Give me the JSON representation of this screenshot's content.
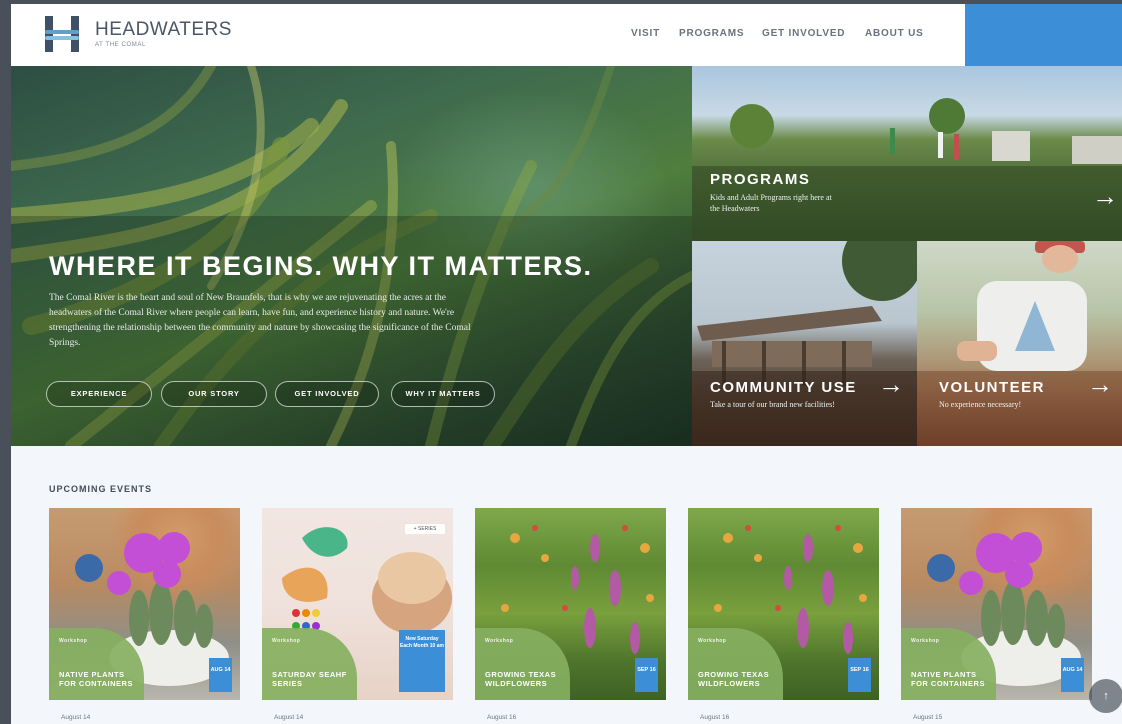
{
  "header": {
    "brand": "HEADWATERS",
    "brand_sub": "AT THE COMAL",
    "nav": [
      "VISIT",
      "PROGRAMS",
      "GET INVOLVED",
      "ABOUT US"
    ]
  },
  "hero": {
    "title": "WHERE IT BEGINS. WHY IT MATTERS.",
    "body": "The Comal River is the heart and soul of New Braunfels, that is why we are rejuvenating the acres at the headwaters of the Comal River where people can learn, have fun, and experience history and nature. We're strengthening the relationship between the community and nature by showcasing the significance of the Comal Springs.",
    "buttons": [
      "EXPERIENCE",
      "OUR STORY",
      "GET INVOLVED",
      "WHY IT MATTERS"
    ]
  },
  "tiles": {
    "programs": {
      "title": "PROGRAMS",
      "desc": "Kids and Adult Programs right here at the Headwaters"
    },
    "community": {
      "title": "COMMUNITY USE",
      "desc": "Take a tour of our brand new facilities!"
    },
    "volunteer": {
      "title": "VOLUNTEER",
      "desc": "No experience necessary!"
    }
  },
  "events": {
    "heading": "UPCOMING EVENTS",
    "cards": [
      {
        "category": "Workshop",
        "title": "NATIVE PLANTS FOR CONTAINERS",
        "date_box": "AUG 14",
        "date": "August 14"
      },
      {
        "category": "Workshop",
        "title": "SATURDAY SEAHF SERIES",
        "date_box": "New Saturday Each Month 10 am",
        "date": "August 14",
        "tag": "+ SERIES"
      },
      {
        "category": "Workshop",
        "title": "GROWING TEXAS WILDFLOWERS",
        "date_box": "SEP 16",
        "date": "August 16"
      },
      {
        "category": "Workshop",
        "title": "GROWING TEXAS WILDFLOWERS",
        "date_box": "SEP 16",
        "date": "August 16"
      },
      {
        "category": "Workshop",
        "title": "NATIVE PLANTS FOR CONTAINERS",
        "date_box": "AUG 14",
        "date": "August 15"
      }
    ]
  },
  "icons": {
    "arrow": "right-arrow-icon",
    "logo": "headwaters-h-logo"
  },
  "colors": {
    "accent_blue": "#3c8fd7",
    "badge_green": "#86b060",
    "header_bg": "#ffffff"
  }
}
